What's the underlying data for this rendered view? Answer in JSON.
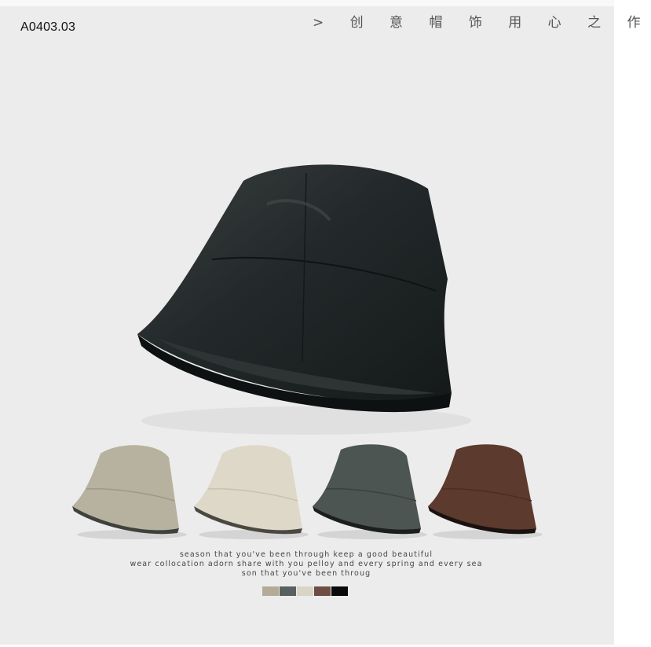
{
  "product_code": "A0403.03",
  "slogan": "> 创 意 帽 饰 用 心 之 作 ]",
  "caption_lines": [
    "season that you've been through keep a good  beautiful",
    "wear collocation adorn share with you  pelloy and every spring and every sea",
    "son that you've been throug"
  ],
  "colors": {
    "main_hat": "#23282a",
    "hats": [
      "#b6b29f",
      "#ddd8c8",
      "#4c5552",
      "#5c3a2d"
    ],
    "swatches": [
      "#b3ab98",
      "#5a5f60",
      "#d9d4c6",
      "#6e4d42",
      "#0a0a0a"
    ]
  }
}
